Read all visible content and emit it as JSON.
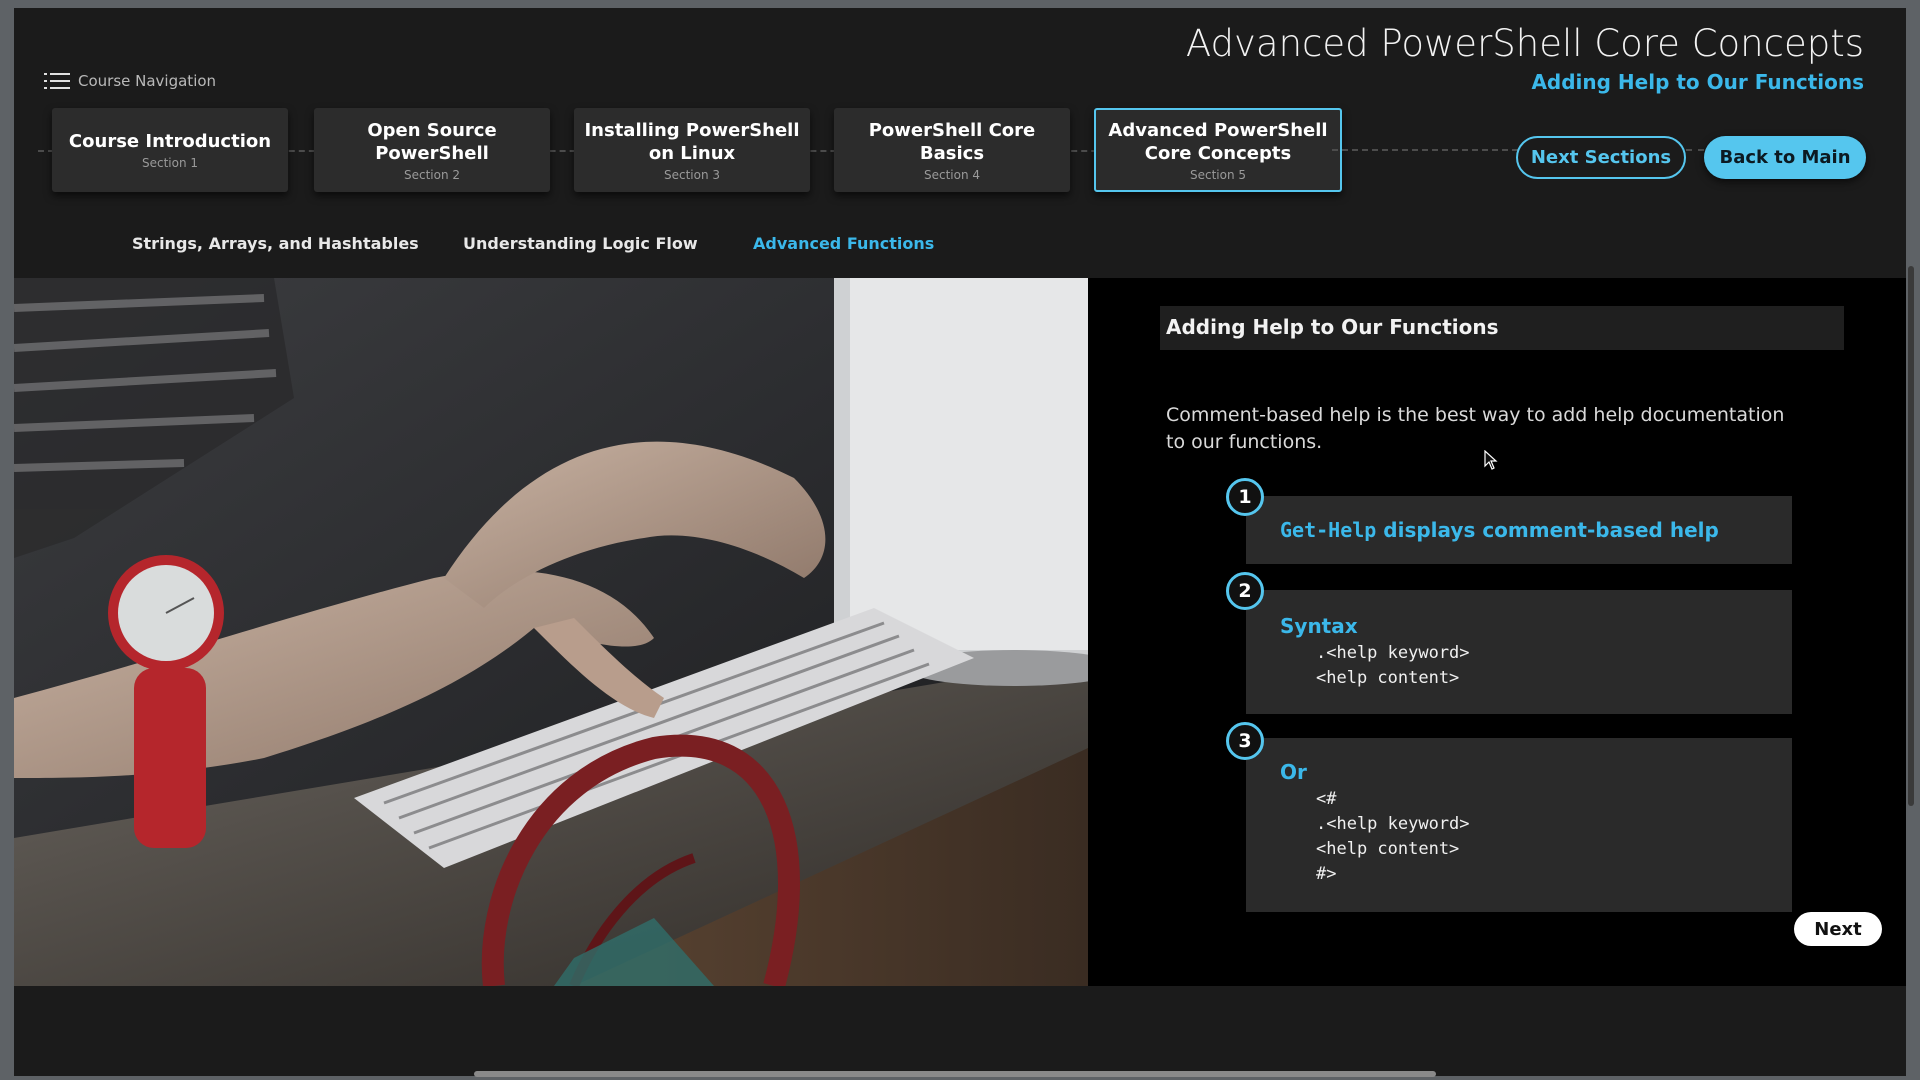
{
  "header": {
    "nav_label": "Course Navigation",
    "title": "Advanced PowerShell Core Concepts",
    "subtitle": "Adding Help to Our Functions"
  },
  "sections": [
    {
      "title": "Course Introduction",
      "section": "Section 1"
    },
    {
      "title": "Open Source PowerShell",
      "section": "Section 2"
    },
    {
      "title": "Installing PowerShell on Linux",
      "section": "Section 3"
    },
    {
      "title": "PowerShell Core Basics",
      "section": "Section 4"
    },
    {
      "title": "Advanced PowerShell Core Concepts",
      "section": "Section 5"
    }
  ],
  "actions": {
    "next_sections": "Next Sections",
    "back_to_main": "Back to Main"
  },
  "subtabs": [
    {
      "label": "Strings, Arrays, and Hashtables"
    },
    {
      "label": "Understanding Logic Flow"
    },
    {
      "label": "Advanced Functions",
      "active": true
    }
  ],
  "panel": {
    "heading": "Adding Help to Our Functions",
    "intro": "Comment-based help is the best way to add help documentation to our functions.",
    "steps": [
      {
        "number": "1",
        "code_word": "Get-Help",
        "text": " displays comment-based help"
      },
      {
        "number": "2",
        "heading": "Syntax",
        "code": ".<help keyword>\n<help content>"
      },
      {
        "number": "3",
        "heading": "Or",
        "code": "<#\n.<help keyword>\n<help content>\n#>"
      }
    ],
    "next_label": "Next"
  },
  "colors": {
    "accent": "#55c6ee",
    "accent_text": "#3bb8ea",
    "background": "#1b1b1b",
    "panel": "#000000"
  }
}
